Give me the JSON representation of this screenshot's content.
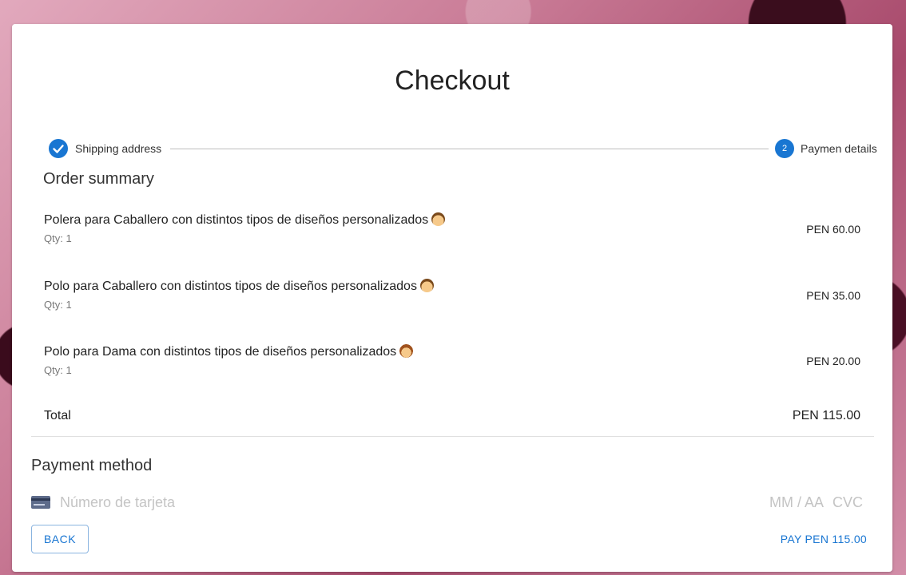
{
  "checkout": {
    "title": "Checkout"
  },
  "stepper": {
    "steps": [
      {
        "label": "Shipping address",
        "state": "completed",
        "icon": "check-icon"
      },
      {
        "label": "Paymen details",
        "state": "active",
        "number": "2"
      }
    ]
  },
  "order_summary": {
    "title": "Order summary",
    "items": [
      {
        "name": "Polera para Caballero con distintos tipos de diseños personalizados",
        "emoji": "man-face-icon",
        "qty": "Qty: 1",
        "price": "PEN 60.00"
      },
      {
        "name": "Polo para Caballero con distintos tipos de diseños personalizados",
        "emoji": "man-face-icon",
        "qty": "Qty: 1",
        "price": "PEN 35.00"
      },
      {
        "name": "Polo para Dama con distintos tipos de diseños personalizados",
        "emoji": "woman-face-icon",
        "qty": "Qty: 1",
        "price": "PEN 20.00"
      }
    ],
    "total_label": "Total",
    "total_value": "PEN 115.00"
  },
  "payment": {
    "title": "Payment method",
    "card_number_placeholder": "Número de tarjeta",
    "expiry_placeholder": "MM / AA",
    "cvc_placeholder": "CVC"
  },
  "actions": {
    "back_label": "BACK",
    "pay_label": "PAY PEN 115.00"
  },
  "colors": {
    "accent": "#1976d2",
    "background": "#b45a7c"
  }
}
